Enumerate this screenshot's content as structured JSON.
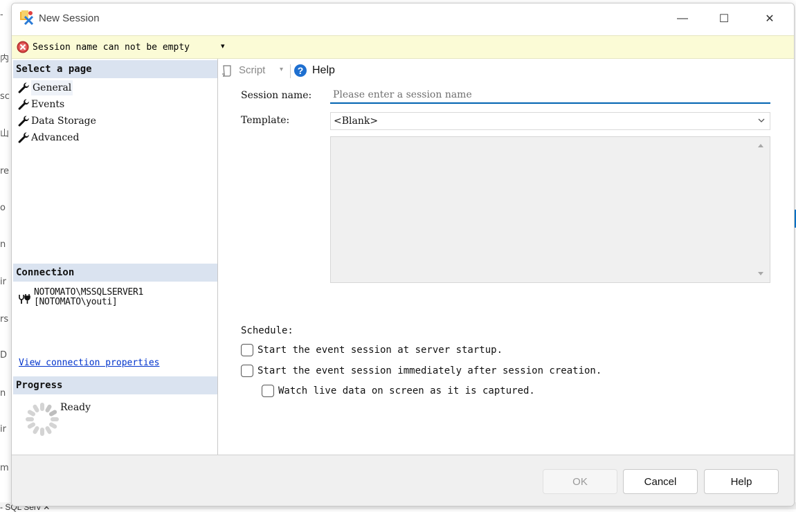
{
  "background": {
    "left_text": [
      "-",
      "内",
      "sc",
      "山",
      "re",
      "o",
      "n",
      "ir",
      "rs",
      "D",
      "n",
      "ir",
      "m"
    ],
    "taskbar_text": "- SQL Serv  ✕"
  },
  "window": {
    "title": "New Session",
    "controls": {
      "minimize": "—",
      "maximize": "☐",
      "close": "✕"
    }
  },
  "error_bar": {
    "message": "Session name can not be empty",
    "caret": "▾",
    "icon": "error-icon",
    "color": "#fbfbd6"
  },
  "left_panel": {
    "select_page_header": "Select a page",
    "pages": [
      {
        "label": "General",
        "icon": "wrench-icon",
        "selected": true
      },
      {
        "label": "Events",
        "icon": "wrench-icon",
        "selected": false
      },
      {
        "label": "Data Storage",
        "icon": "wrench-icon",
        "selected": false
      },
      {
        "label": "Advanced",
        "icon": "wrench-icon",
        "selected": false
      }
    ],
    "connection_header": "Connection",
    "connection_server": "NOTOMATO\\MSSQLSERVER1",
    "connection_user": "[NOTOMATO\\youti]",
    "connection_link": "View connection properties",
    "progress_header": "Progress",
    "progress_status": "Ready"
  },
  "toolbar": {
    "script_label": "Script",
    "script_caret": "▾",
    "help_label": "Help"
  },
  "form": {
    "session_name_label": "Session name:",
    "session_name_placeholder": "Please enter a session name",
    "session_name_value": "",
    "template_label": "Template:",
    "template_value": "<Blank>",
    "schedule_label": "Schedule:",
    "checkboxes": [
      {
        "label": "Start the event session at server startup.",
        "checked": false
      },
      {
        "label": "Start the event session immediately after session creation.",
        "checked": false
      },
      {
        "label": "Watch live data on screen as it is captured.",
        "checked": false
      }
    ]
  },
  "footer": {
    "ok_label": "OK",
    "cancel_label": "Cancel",
    "help_label": "Help"
  },
  "colors": {
    "accent": "#0063b1",
    "section_header": "#dae3f0",
    "link": "#0033cc"
  }
}
